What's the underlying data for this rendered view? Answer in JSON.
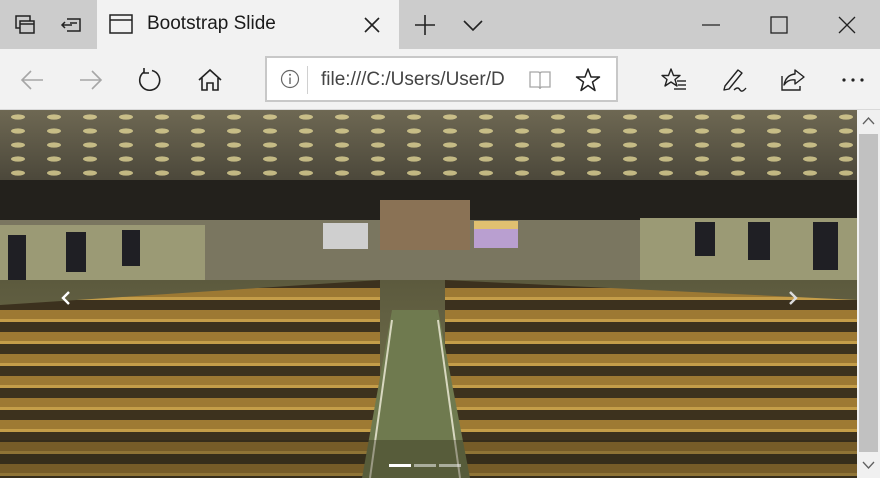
{
  "browser": {
    "tab_title": "Bootstrap Slide",
    "address": "file:///C:/Users/User/D",
    "colors": {
      "titlebar": "#cccccc",
      "active_tab": "#f2f2f2",
      "navbar": "#f2f2f2"
    },
    "icons": {
      "tab_actions": "tab-actions-icon",
      "set_aside": "set-aside-tabs-icon",
      "page_icon": "page-icon",
      "close_tab": "close-icon",
      "new_tab": "plus-icon",
      "tab_menu": "chevron-down-icon",
      "back": "back-arrow-icon",
      "forward": "forward-arrow-icon",
      "refresh": "refresh-icon",
      "home": "home-icon",
      "info": "info-icon",
      "reading_view": "book-icon",
      "favorite": "star-icon",
      "favorites_list": "favorites-icon",
      "ink": "pen-icon",
      "share": "share-icon",
      "more": "more-icon"
    }
  },
  "carousel": {
    "description_icons": {
      "prev": "chevron-left-icon",
      "next": "chevron-right-icon"
    },
    "slide_count": 3,
    "active_index": 0
  }
}
